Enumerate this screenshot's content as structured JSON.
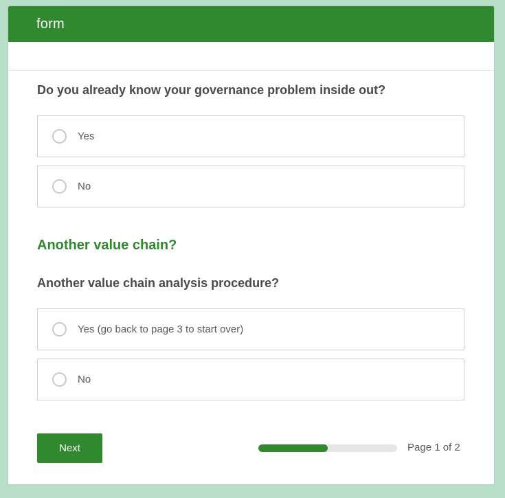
{
  "header": {
    "title": "form"
  },
  "questions": [
    {
      "text": "Do you already know your governance problem inside out?",
      "options": [
        "Yes",
        "No"
      ]
    }
  ],
  "section": {
    "title": "Another value chain?",
    "question": "Another value chain analysis procedure?",
    "options": [
      "Yes (go back to page 3 to start over)",
      "No"
    ]
  },
  "footer": {
    "next_label": "Next",
    "progress_fraction": 0.5,
    "page_label": "Page 1 of 2"
  },
  "colors": {
    "accent": "#31892f",
    "background": "#b9dfcb",
    "progress_track": "#e6e6e6"
  }
}
